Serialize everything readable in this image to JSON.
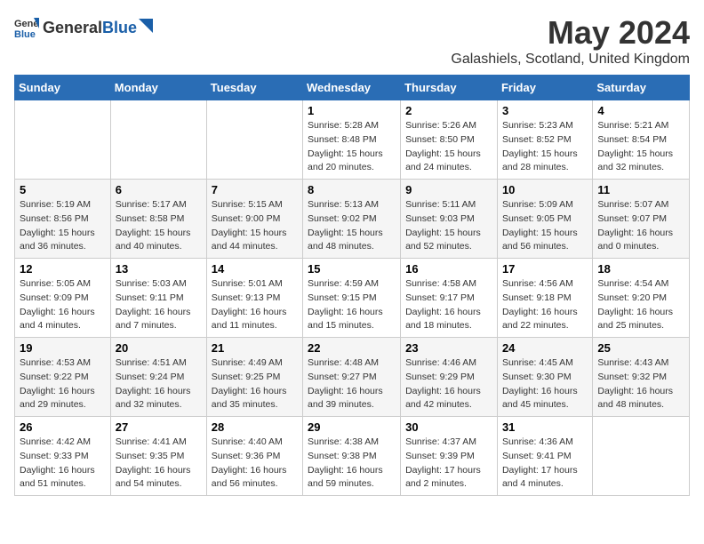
{
  "header": {
    "logo_general": "General",
    "logo_blue": "Blue",
    "title": "May 2024",
    "subtitle": "Galashiels, Scotland, United Kingdom"
  },
  "calendar": {
    "days_of_week": [
      "Sunday",
      "Monday",
      "Tuesday",
      "Wednesday",
      "Thursday",
      "Friday",
      "Saturday"
    ],
    "weeks": [
      [
        {
          "day": "",
          "info": ""
        },
        {
          "day": "",
          "info": ""
        },
        {
          "day": "",
          "info": ""
        },
        {
          "day": "1",
          "info": "Sunrise: 5:28 AM\nSunset: 8:48 PM\nDaylight: 15 hours\nand 20 minutes."
        },
        {
          "day": "2",
          "info": "Sunrise: 5:26 AM\nSunset: 8:50 PM\nDaylight: 15 hours\nand 24 minutes."
        },
        {
          "day": "3",
          "info": "Sunrise: 5:23 AM\nSunset: 8:52 PM\nDaylight: 15 hours\nand 28 minutes."
        },
        {
          "day": "4",
          "info": "Sunrise: 5:21 AM\nSunset: 8:54 PM\nDaylight: 15 hours\nand 32 minutes."
        }
      ],
      [
        {
          "day": "5",
          "info": "Sunrise: 5:19 AM\nSunset: 8:56 PM\nDaylight: 15 hours\nand 36 minutes."
        },
        {
          "day": "6",
          "info": "Sunrise: 5:17 AM\nSunset: 8:58 PM\nDaylight: 15 hours\nand 40 minutes."
        },
        {
          "day": "7",
          "info": "Sunrise: 5:15 AM\nSunset: 9:00 PM\nDaylight: 15 hours\nand 44 minutes."
        },
        {
          "day": "8",
          "info": "Sunrise: 5:13 AM\nSunset: 9:02 PM\nDaylight: 15 hours\nand 48 minutes."
        },
        {
          "day": "9",
          "info": "Sunrise: 5:11 AM\nSunset: 9:03 PM\nDaylight: 15 hours\nand 52 minutes."
        },
        {
          "day": "10",
          "info": "Sunrise: 5:09 AM\nSunset: 9:05 PM\nDaylight: 15 hours\nand 56 minutes."
        },
        {
          "day": "11",
          "info": "Sunrise: 5:07 AM\nSunset: 9:07 PM\nDaylight: 16 hours\nand 0 minutes."
        }
      ],
      [
        {
          "day": "12",
          "info": "Sunrise: 5:05 AM\nSunset: 9:09 PM\nDaylight: 16 hours\nand 4 minutes."
        },
        {
          "day": "13",
          "info": "Sunrise: 5:03 AM\nSunset: 9:11 PM\nDaylight: 16 hours\nand 7 minutes."
        },
        {
          "day": "14",
          "info": "Sunrise: 5:01 AM\nSunset: 9:13 PM\nDaylight: 16 hours\nand 11 minutes."
        },
        {
          "day": "15",
          "info": "Sunrise: 4:59 AM\nSunset: 9:15 PM\nDaylight: 16 hours\nand 15 minutes."
        },
        {
          "day": "16",
          "info": "Sunrise: 4:58 AM\nSunset: 9:17 PM\nDaylight: 16 hours\nand 18 minutes."
        },
        {
          "day": "17",
          "info": "Sunrise: 4:56 AM\nSunset: 9:18 PM\nDaylight: 16 hours\nand 22 minutes."
        },
        {
          "day": "18",
          "info": "Sunrise: 4:54 AM\nSunset: 9:20 PM\nDaylight: 16 hours\nand 25 minutes."
        }
      ],
      [
        {
          "day": "19",
          "info": "Sunrise: 4:53 AM\nSunset: 9:22 PM\nDaylight: 16 hours\nand 29 minutes."
        },
        {
          "day": "20",
          "info": "Sunrise: 4:51 AM\nSunset: 9:24 PM\nDaylight: 16 hours\nand 32 minutes."
        },
        {
          "day": "21",
          "info": "Sunrise: 4:49 AM\nSunset: 9:25 PM\nDaylight: 16 hours\nand 35 minutes."
        },
        {
          "day": "22",
          "info": "Sunrise: 4:48 AM\nSunset: 9:27 PM\nDaylight: 16 hours\nand 39 minutes."
        },
        {
          "day": "23",
          "info": "Sunrise: 4:46 AM\nSunset: 9:29 PM\nDaylight: 16 hours\nand 42 minutes."
        },
        {
          "day": "24",
          "info": "Sunrise: 4:45 AM\nSunset: 9:30 PM\nDaylight: 16 hours\nand 45 minutes."
        },
        {
          "day": "25",
          "info": "Sunrise: 4:43 AM\nSunset: 9:32 PM\nDaylight: 16 hours\nand 48 minutes."
        }
      ],
      [
        {
          "day": "26",
          "info": "Sunrise: 4:42 AM\nSunset: 9:33 PM\nDaylight: 16 hours\nand 51 minutes."
        },
        {
          "day": "27",
          "info": "Sunrise: 4:41 AM\nSunset: 9:35 PM\nDaylight: 16 hours\nand 54 minutes."
        },
        {
          "day": "28",
          "info": "Sunrise: 4:40 AM\nSunset: 9:36 PM\nDaylight: 16 hours\nand 56 minutes."
        },
        {
          "day": "29",
          "info": "Sunrise: 4:38 AM\nSunset: 9:38 PM\nDaylight: 16 hours\nand 59 minutes."
        },
        {
          "day": "30",
          "info": "Sunrise: 4:37 AM\nSunset: 9:39 PM\nDaylight: 17 hours\nand 2 minutes."
        },
        {
          "day": "31",
          "info": "Sunrise: 4:36 AM\nSunset: 9:41 PM\nDaylight: 17 hours\nand 4 minutes."
        },
        {
          "day": "",
          "info": ""
        }
      ]
    ]
  }
}
